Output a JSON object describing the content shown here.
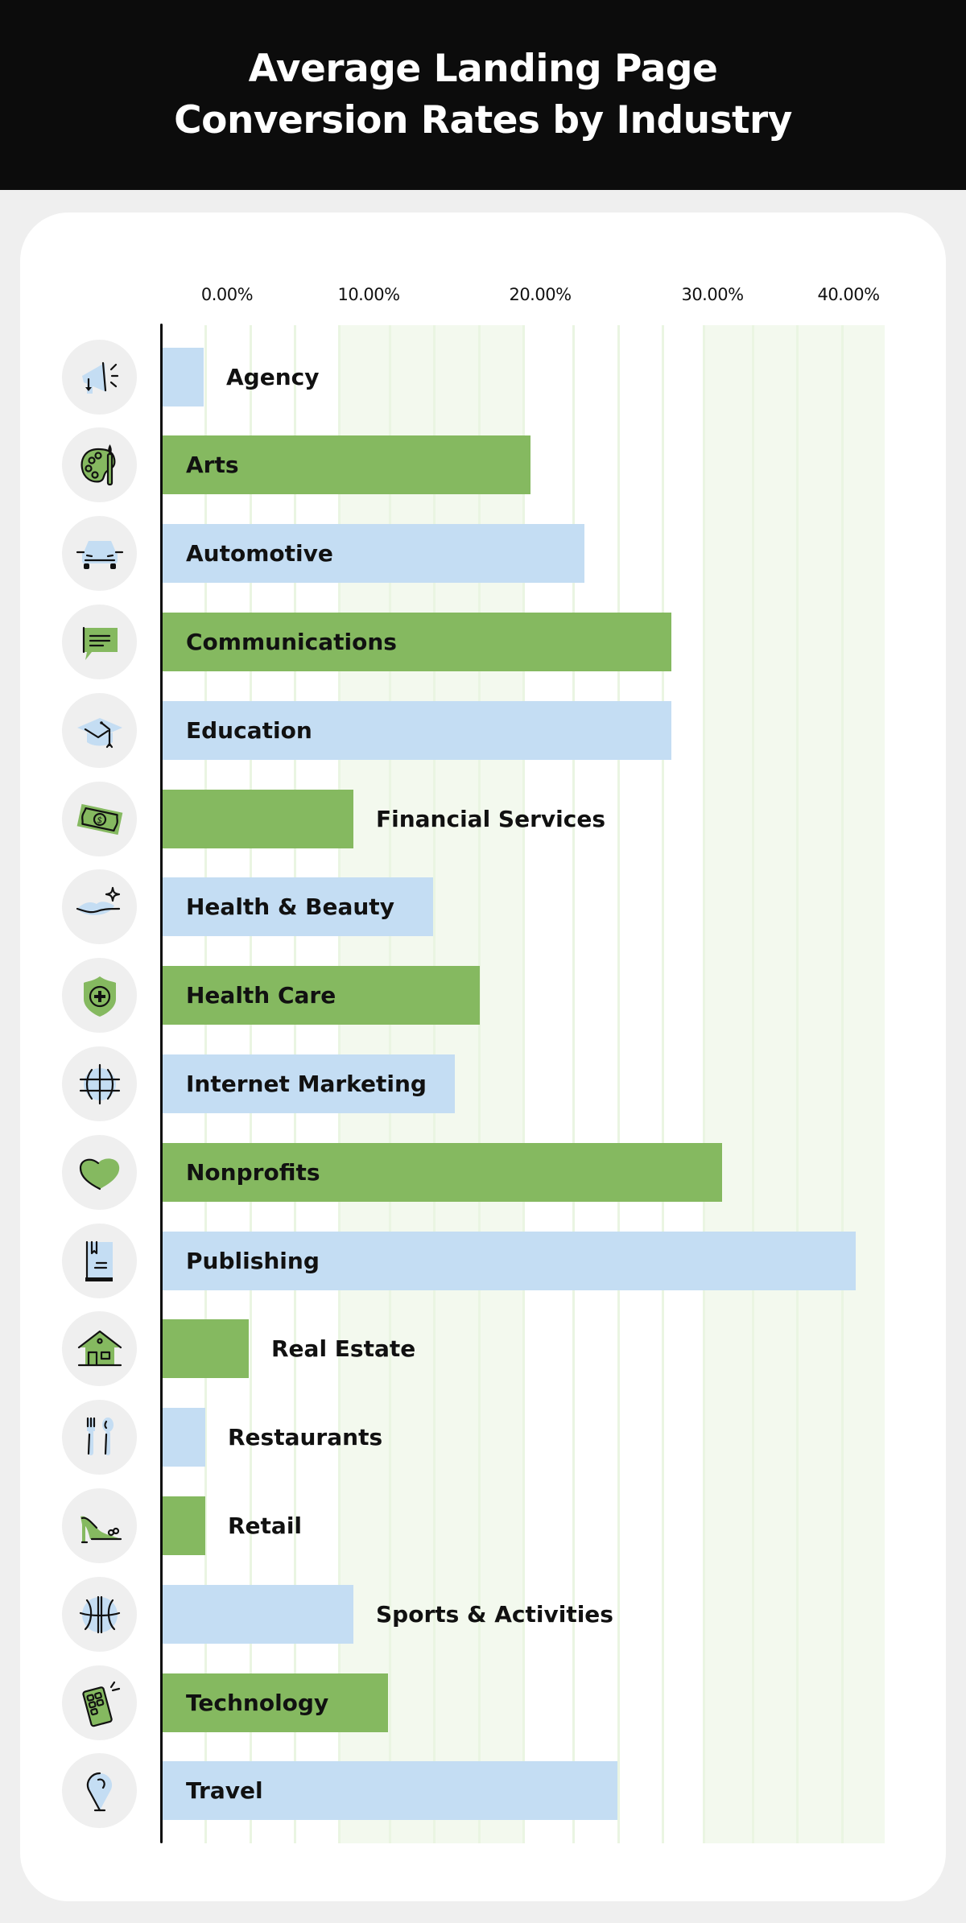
{
  "header": {
    "title_line_1": "Average Landing Page",
    "title_line_2": "Conversion Rates by Industry"
  },
  "colors": {
    "header_bg": "#0c0c0c",
    "page_bg": "#efefef",
    "bar_blue": "#c4ddf3",
    "bar_green": "#85b960",
    "band": "#f3f9ee",
    "gridline": "#eaf5e2",
    "icon_bg": "#efefef"
  },
  "chart_data": {
    "type": "bar",
    "orientation": "horizontal",
    "title": "Average Landing Page Conversion Rates by Industry",
    "xlabel": "",
    "ylabel": "",
    "xlim": [
      0,
      40
    ],
    "x_ticks": [
      "0.00%",
      "10.00%",
      "20.00%",
      "30.00%",
      "40.00%"
    ],
    "grid": true,
    "legend": "none",
    "unit": "%",
    "categories": [
      "Agency",
      "Arts",
      "Automotive",
      "Communications",
      "Education",
      "Financial Services",
      "Health & Beauty",
      "Health Care",
      "Internet Marketing",
      "Nonprofits",
      "Publishing",
      "Real Estate",
      "Restaurants",
      "Retail",
      "Sports & Activities",
      "Technology",
      "Travel"
    ],
    "values": [
      2.3,
      20.4,
      23.4,
      28.2,
      28.2,
      10.6,
      15.0,
      17.6,
      16.2,
      31.0,
      38.4,
      4.8,
      2.4,
      2.4,
      10.6,
      12.5,
      25.2
    ],
    "bar_colors": [
      "blue",
      "green",
      "blue",
      "green",
      "blue",
      "green",
      "blue",
      "green",
      "blue",
      "green",
      "blue",
      "green",
      "blue",
      "green",
      "blue",
      "green",
      "blue"
    ],
    "icons": [
      "megaphone-icon",
      "paint-palette-icon",
      "car-icon",
      "chat-bubble-icon",
      "graduation-cap-icon",
      "dollar-bill-icon",
      "lips-sparkle-icon",
      "medical-shield-icon",
      "globe-icon",
      "heart-icon",
      "book-icon",
      "house-icon",
      "fork-spoon-icon",
      "high-heel-shoe-icon",
      "basketball-icon",
      "mobile-phone-icon",
      "map-pin-icon"
    ]
  }
}
